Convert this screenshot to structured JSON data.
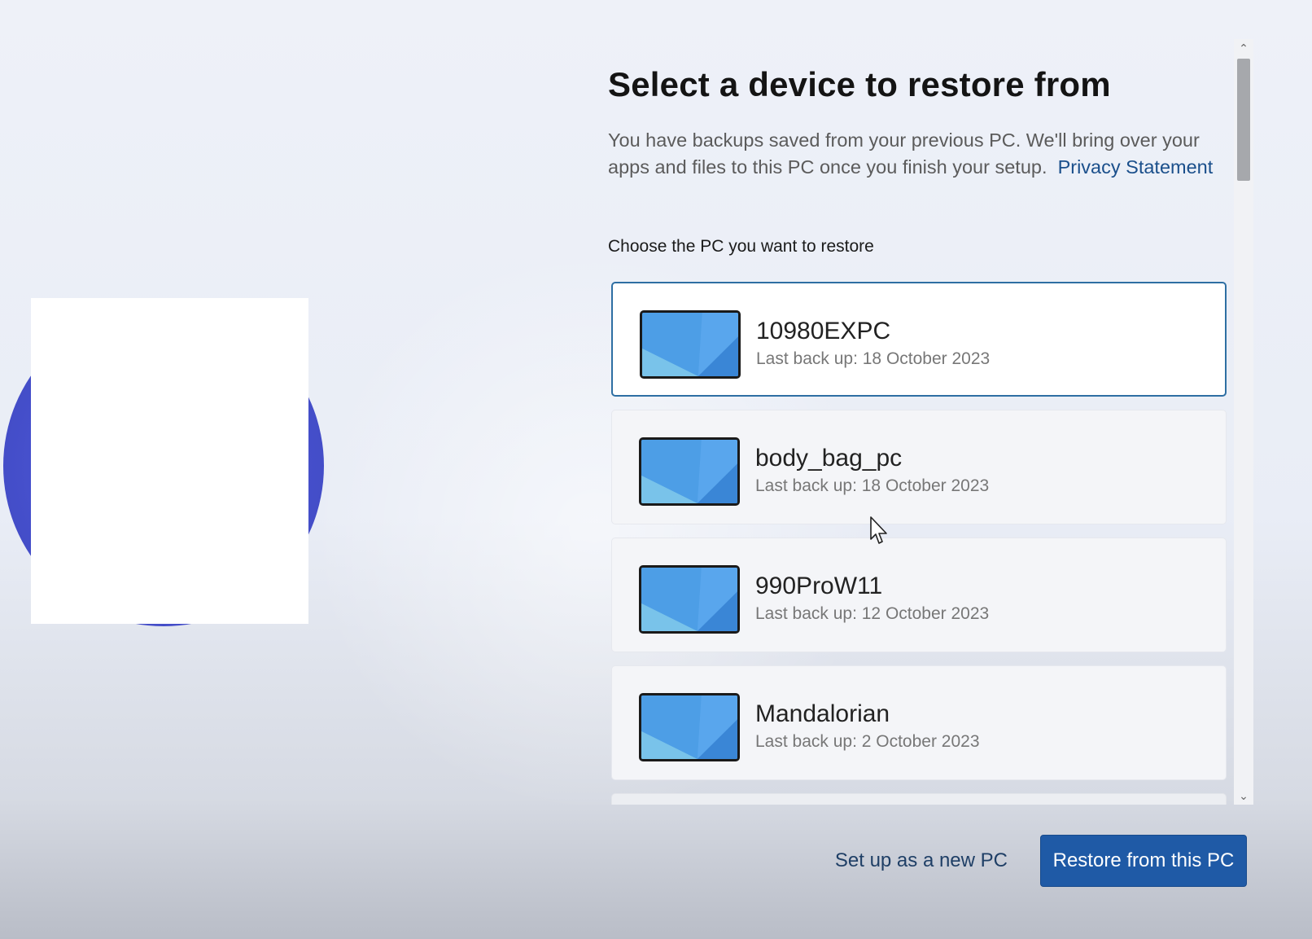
{
  "page": {
    "title": "Select a device to restore from",
    "description": "You have backups saved from your previous PC. We'll bring over your apps and files to this PC once you finish your setup.",
    "privacy_link": "Privacy Statement",
    "choose_label": "Choose the PC you want to restore"
  },
  "devices": [
    {
      "name": "10980EXPC",
      "last_backup": "Last back up: 18 October 2023",
      "selected": true
    },
    {
      "name": "body_bag_pc",
      "last_backup": "Last back up: 18 October 2023",
      "selected": false
    },
    {
      "name": "990ProW11",
      "last_backup": "Last back up: 12 October 2023",
      "selected": false
    },
    {
      "name": "Mandalorian",
      "last_backup": "Last back up: 2 October 2023",
      "selected": false
    }
  ],
  "actions": {
    "setup_new": "Set up as a new PC",
    "restore": "Restore from this PC"
  },
  "icons": {
    "scroll_up": "chevron-up-icon",
    "scroll_down": "chevron-down-icon",
    "device": "laptop-screen-icon",
    "cursor": "mouse-pointer-icon"
  },
  "colors": {
    "accent": "#1f5aa6",
    "link": "#1a4f8b",
    "selected_border": "#2e6fa3",
    "blob": "#4650cc"
  }
}
